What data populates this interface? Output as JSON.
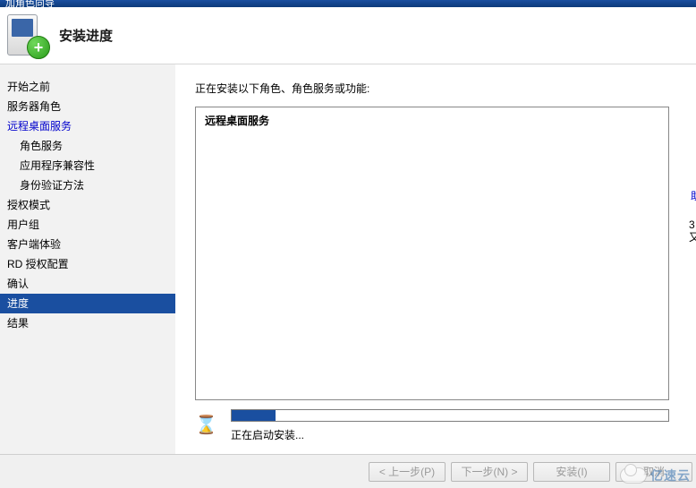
{
  "window": {
    "title_fragment": "加角色向导"
  },
  "header": {
    "title": "安装进度",
    "plus_glyph": "+"
  },
  "sidebar": {
    "items": [
      {
        "label": "开始之前",
        "indent": false
      },
      {
        "label": "服务器角色",
        "indent": false
      },
      {
        "label": "远程桌面服务",
        "indent": false,
        "link": true
      },
      {
        "label": "角色服务",
        "indent": true
      },
      {
        "label": "应用程序兼容性",
        "indent": true
      },
      {
        "label": "身份验证方法",
        "indent": true
      },
      {
        "label": "授权模式",
        "indent": false
      },
      {
        "label": "用户组",
        "indent": false
      },
      {
        "label": "客户端体验",
        "indent": false
      },
      {
        "label": "RD 授权配置",
        "indent": false
      },
      {
        "label": "确认",
        "indent": false
      },
      {
        "label": "进度",
        "indent": false,
        "selected": true
      },
      {
        "label": "结果",
        "indent": false
      }
    ]
  },
  "main": {
    "installing_label": "正在安装以下角色、角色服务或功能:",
    "role_title": "远程桌面服务",
    "progress_text": "正在启动安装..."
  },
  "footer": {
    "prev": "< 上一步(P)",
    "next": "下一步(N) >",
    "install": "安装(I)",
    "cancel": "取消"
  },
  "watermark": {
    "text": "亿速云"
  },
  "edge": {
    "blue": "助",
    "chars": "3又"
  }
}
